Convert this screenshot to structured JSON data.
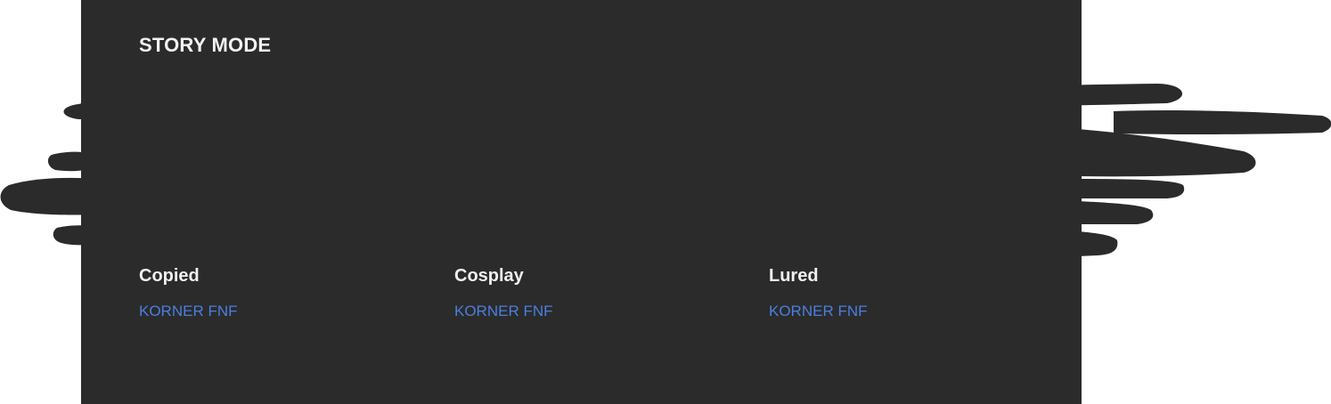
{
  "section": {
    "title": "STORY MODE"
  },
  "cards": [
    {
      "title": "Copied",
      "author": "KORNER FNF"
    },
    {
      "title": "Cosplay",
      "author": "KORNER FNF"
    },
    {
      "title": "Lured",
      "author": "KORNER FNF"
    }
  ],
  "colors": {
    "panel_background": "#2b2b2b",
    "title_text": "#f2f2f2",
    "author_link": "#4a7fe0",
    "redaction_marker": "#2b2b2b"
  }
}
